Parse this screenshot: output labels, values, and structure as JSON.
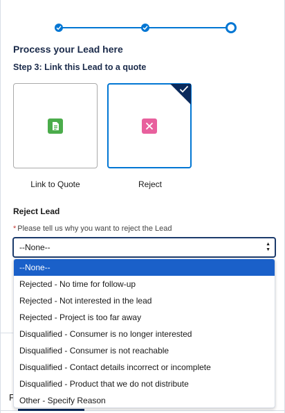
{
  "progress": {
    "steps_completed": 2,
    "steps_total": 3,
    "current_step": 3,
    "color": "#0176d3"
  },
  "header": {
    "title": "Process your Lead here",
    "step": "Step 3: Link this Lead to a quote"
  },
  "tiles": [
    {
      "label": "Link to Quote",
      "icon": "quote-document-icon",
      "icon_color": "#4bac4b",
      "selected": false
    },
    {
      "label": "Reject",
      "icon": "close-icon",
      "icon_color": "#e8609d",
      "selected": true
    }
  ],
  "reject": {
    "section_label": "Reject Lead",
    "required_mark": "*",
    "field_label": "Please tell us why you want to reject the Lead",
    "selected_value": "--None--",
    "options": [
      "--None--",
      "Rejected - No time for follow-up",
      "Rejected - Not interested in the lead",
      "Rejected - Project is too far away",
      "Disqualified - Consumer is no longer interested",
      "Disqualified - Consumer is not reachable",
      "Disqualified - Contact details incorrect or incomplete",
      "Disqualified - Product that we do not distribute",
      "Other - Specify Reason"
    ],
    "highlight_color": "#1a60c9"
  },
  "background": {
    "partial_tab_text": "F"
  }
}
